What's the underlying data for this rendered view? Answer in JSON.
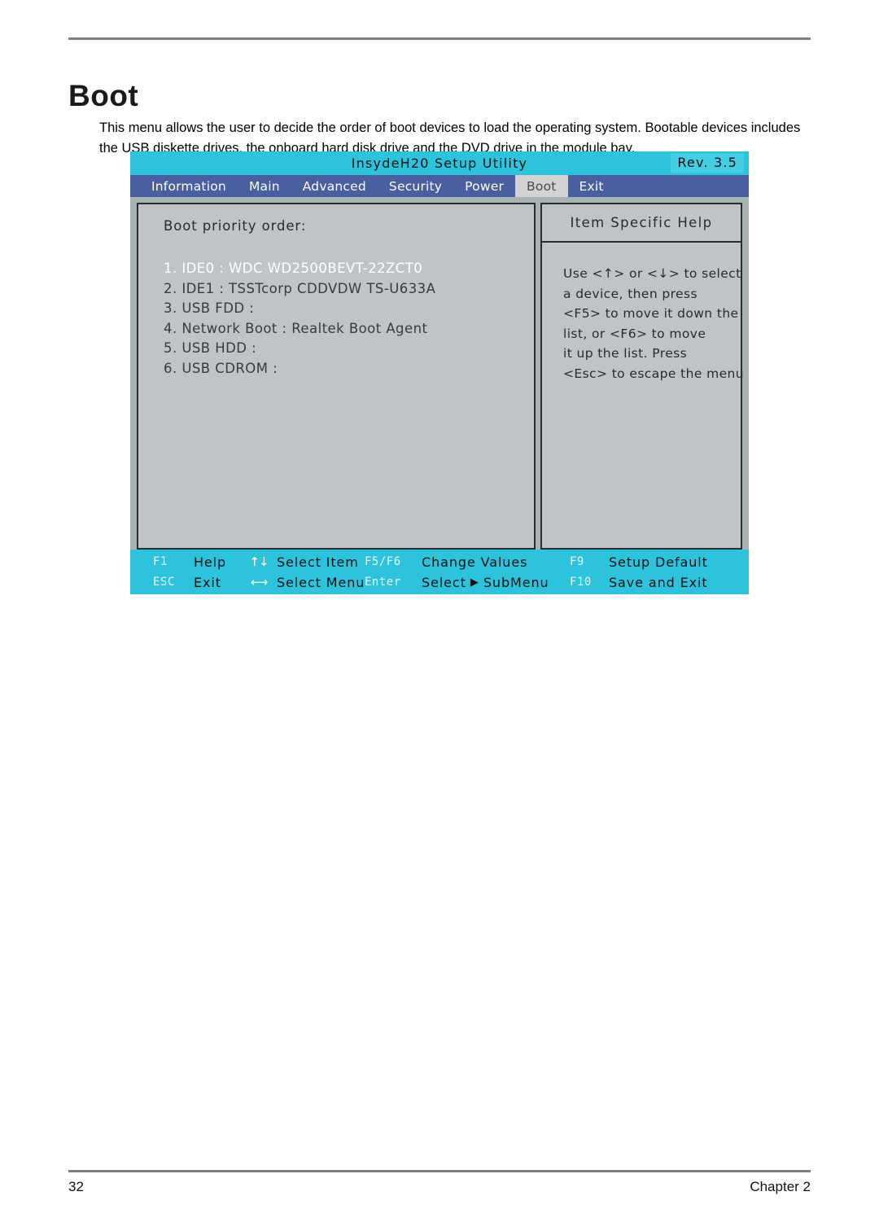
{
  "document": {
    "title": "Boot",
    "intro": "This menu allows the user to decide the order of boot devices to load the operating system. Bootable devices includes the USB diskette drives, the onboard hard disk drive and the DVD drive in the module bay.",
    "footer_page": "32",
    "footer_chapter": "Chapter 2"
  },
  "bios": {
    "title": "InsydeH20 Setup Utility",
    "revision": "Rev. 3.5",
    "tabs": [
      {
        "label": "Information",
        "active": false
      },
      {
        "label": "Main",
        "active": false
      },
      {
        "label": "Advanced",
        "active": false
      },
      {
        "label": "Security",
        "active": false
      },
      {
        "label": "Power",
        "active": false
      },
      {
        "label": "Boot",
        "active": true
      },
      {
        "label": "Exit",
        "active": false
      }
    ],
    "boot": {
      "section_label": "Boot priority order:",
      "items": [
        {
          "text": "1. IDE0 : WDC WD2500BEVT-22ZCT0",
          "selected": true
        },
        {
          "text": "2. IDE1 : TSSTcorp CDDVDW TS-U633A",
          "selected": false
        },
        {
          "text": "3. USB FDD :",
          "selected": false
        },
        {
          "text": "4. Network Boot : Realtek Boot Agent",
          "selected": false
        },
        {
          "text": "5. USB HDD :",
          "selected": false
        },
        {
          "text": "6. USB CDROM :",
          "selected": false
        }
      ]
    },
    "help": {
      "header": "Item Specific Help",
      "lines": [
        "Use <↑> or <↓> to select",
        "a device, then press",
        "<F5> to move it down the",
        "list, or <F6> to move",
        "it up the list. Press",
        "<Esc> to escape the menu"
      ]
    },
    "function_bar": {
      "row1": {
        "key1": "F1",
        "desc1": "Help",
        "arrow": "↑↓",
        "desc2": "Select Item",
        "key2": "F5/F6",
        "desc3": "Change Values",
        "key3": "F9",
        "desc4": "Setup Default"
      },
      "row2": {
        "key1": "ESC",
        "desc1": "Exit",
        "arrow": "⟷",
        "desc2": "Select Menu",
        "key2": "Enter",
        "desc3a": "Select",
        "triangle": "▶",
        "desc3b": "SubMenu",
        "key3": "F10",
        "desc4": "Save and Exit"
      }
    },
    "colors": {
      "titlebar": "#2ec3dd",
      "tabbar": "#4a5fa0",
      "active_tab": "#d2d2d2",
      "panel_fill": "#c0c4c8",
      "screen_bg": "#a6b3b0"
    }
  }
}
